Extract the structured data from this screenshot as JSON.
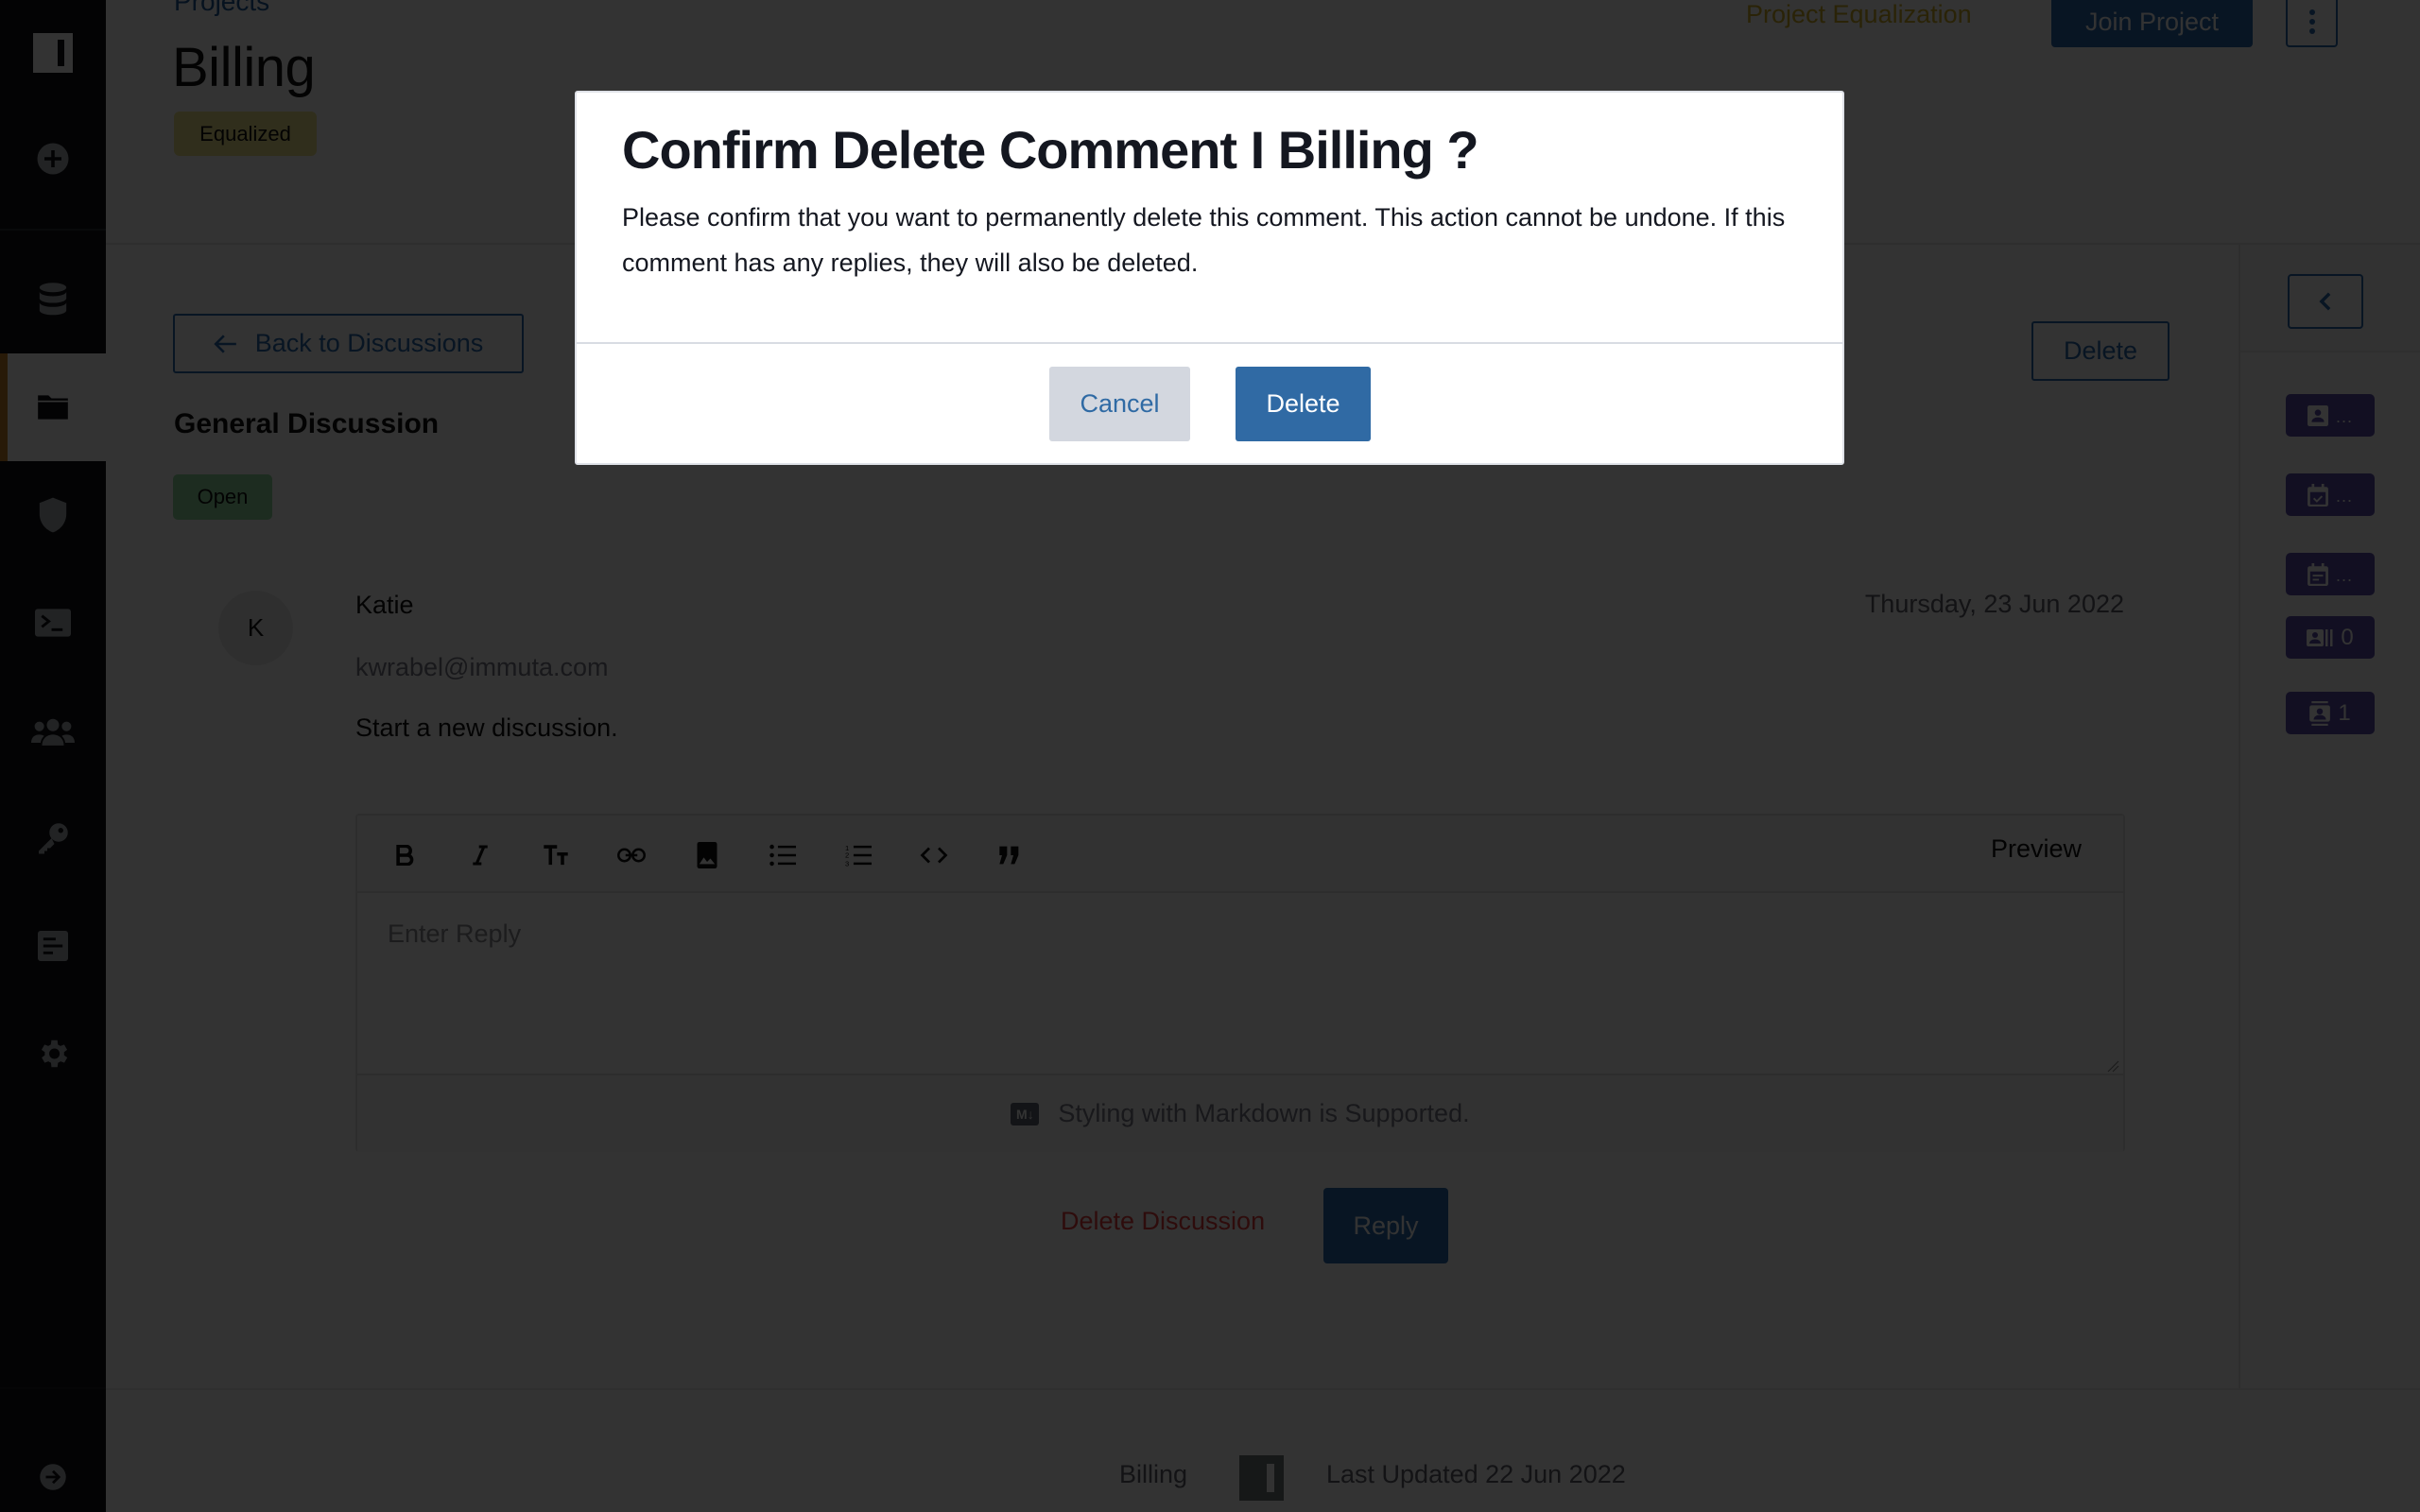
{
  "header": {
    "breadcrumb": "Projects",
    "title": "Billing",
    "status_badge": "Equalized",
    "project_equalization_link": "Project Equalization",
    "join_button": "Join Project",
    "more_menu_icon": "kebab-vertical-icon"
  },
  "sidebar": {
    "logo": "immuta-logo",
    "items": [
      {
        "icon": "plus-circle-icon",
        "active": false
      },
      {
        "icon": "database-icon",
        "active": false
      },
      {
        "icon": "folder-icon",
        "active": true
      },
      {
        "icon": "shield-icon",
        "active": false
      },
      {
        "icon": "terminal-icon",
        "active": false
      },
      {
        "icon": "users-icon",
        "active": false
      },
      {
        "icon": "key-icon",
        "active": false
      },
      {
        "icon": "report-icon",
        "active": false
      },
      {
        "icon": "gear-icon",
        "active": false
      }
    ],
    "bottom_item": {
      "icon": "arrow-right-circle-icon"
    }
  },
  "discussion": {
    "back_button": "Back to Discussions",
    "title": "General Discussion",
    "status_badge": "Open",
    "delete_button": "Delete",
    "comment": {
      "avatar_initial": "K",
      "author": "Katie",
      "email": "kwrabel@immuta.com",
      "body": "Start a new discussion.",
      "date": "Thursday, 23 Jun 2022"
    },
    "editor": {
      "toolbar": [
        "bold",
        "italic",
        "heading",
        "link",
        "image",
        "bulleted-list",
        "numbered-list",
        "code",
        "quote"
      ],
      "preview_button": "Preview",
      "placeholder": "Enter Reply",
      "value": "",
      "markdown_note": "Styling with Markdown is Supported.",
      "markdown_icon_label": "M↓"
    },
    "delete_discussion_button": "Delete Discussion",
    "reply_button": "Reply"
  },
  "right_panel": {
    "collapse_icon": "chevron-left-icon",
    "badges": [
      {
        "icon": "user-card-icon",
        "value": "..."
      },
      {
        "icon": "calendar-check-icon",
        "value": "..."
      },
      {
        "icon": "calendar-note-icon",
        "value": "..."
      },
      {
        "icon": "id-card-icon",
        "value": "0"
      },
      {
        "icon": "contacts-icon",
        "value": "1"
      }
    ]
  },
  "footer": {
    "project_name": "Billing",
    "last_updated": "Last Updated 22 Jun 2022"
  },
  "modal": {
    "title": "Confirm Delete Comment I Billing ?",
    "body": "Please confirm that you want to permanently delete this comment. This action cannot be undone. If this comment has any replies, they will also be deleted.",
    "cancel_button": "Cancel",
    "confirm_button": "Delete"
  },
  "colors": {
    "primary": "#2b6cb0",
    "modal_primary": "#306aa4",
    "danger": "#e53e3e",
    "sidebar_bg": "#101216",
    "active_accent": "#c9822a",
    "equalized_badge": "#f1e48a",
    "open_badge": "#8fdca0",
    "right_panel_badge": "#5a4ea8"
  }
}
